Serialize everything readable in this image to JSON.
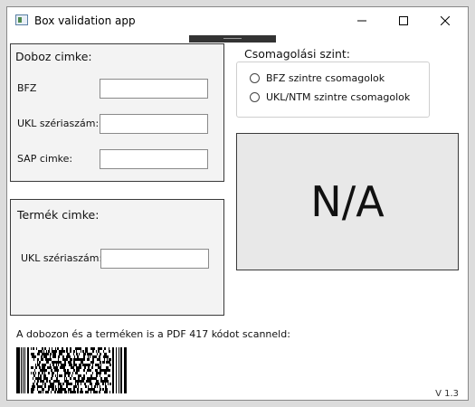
{
  "window": {
    "title": "Box validation app",
    "version": "V 1.3"
  },
  "box_label": {
    "title": "Doboz cimke:",
    "fields": [
      {
        "label": "BFZ",
        "value": ""
      },
      {
        "label": "UKL szériaszám:",
        "value": ""
      },
      {
        "label": "SAP cimke:",
        "value": ""
      }
    ]
  },
  "product_label": {
    "title": "Termék cimke:",
    "fields": [
      {
        "label": "UKL szériaszám:",
        "value": ""
      }
    ]
  },
  "packaging": {
    "title": "Csomagolási szint:",
    "options": [
      {
        "label": "BFZ szintre csomagolok",
        "selected": false
      },
      {
        "label": "UKL/NTM szintre csomagolok",
        "selected": false
      }
    ]
  },
  "status_display": "N/A",
  "instruction": "A dobozon és a terméken is a PDF 417 kódot scanneld:",
  "icons": [
    "app-icon",
    "minimize-icon",
    "maximize-icon",
    "close-icon",
    "pdf417-barcode"
  ]
}
